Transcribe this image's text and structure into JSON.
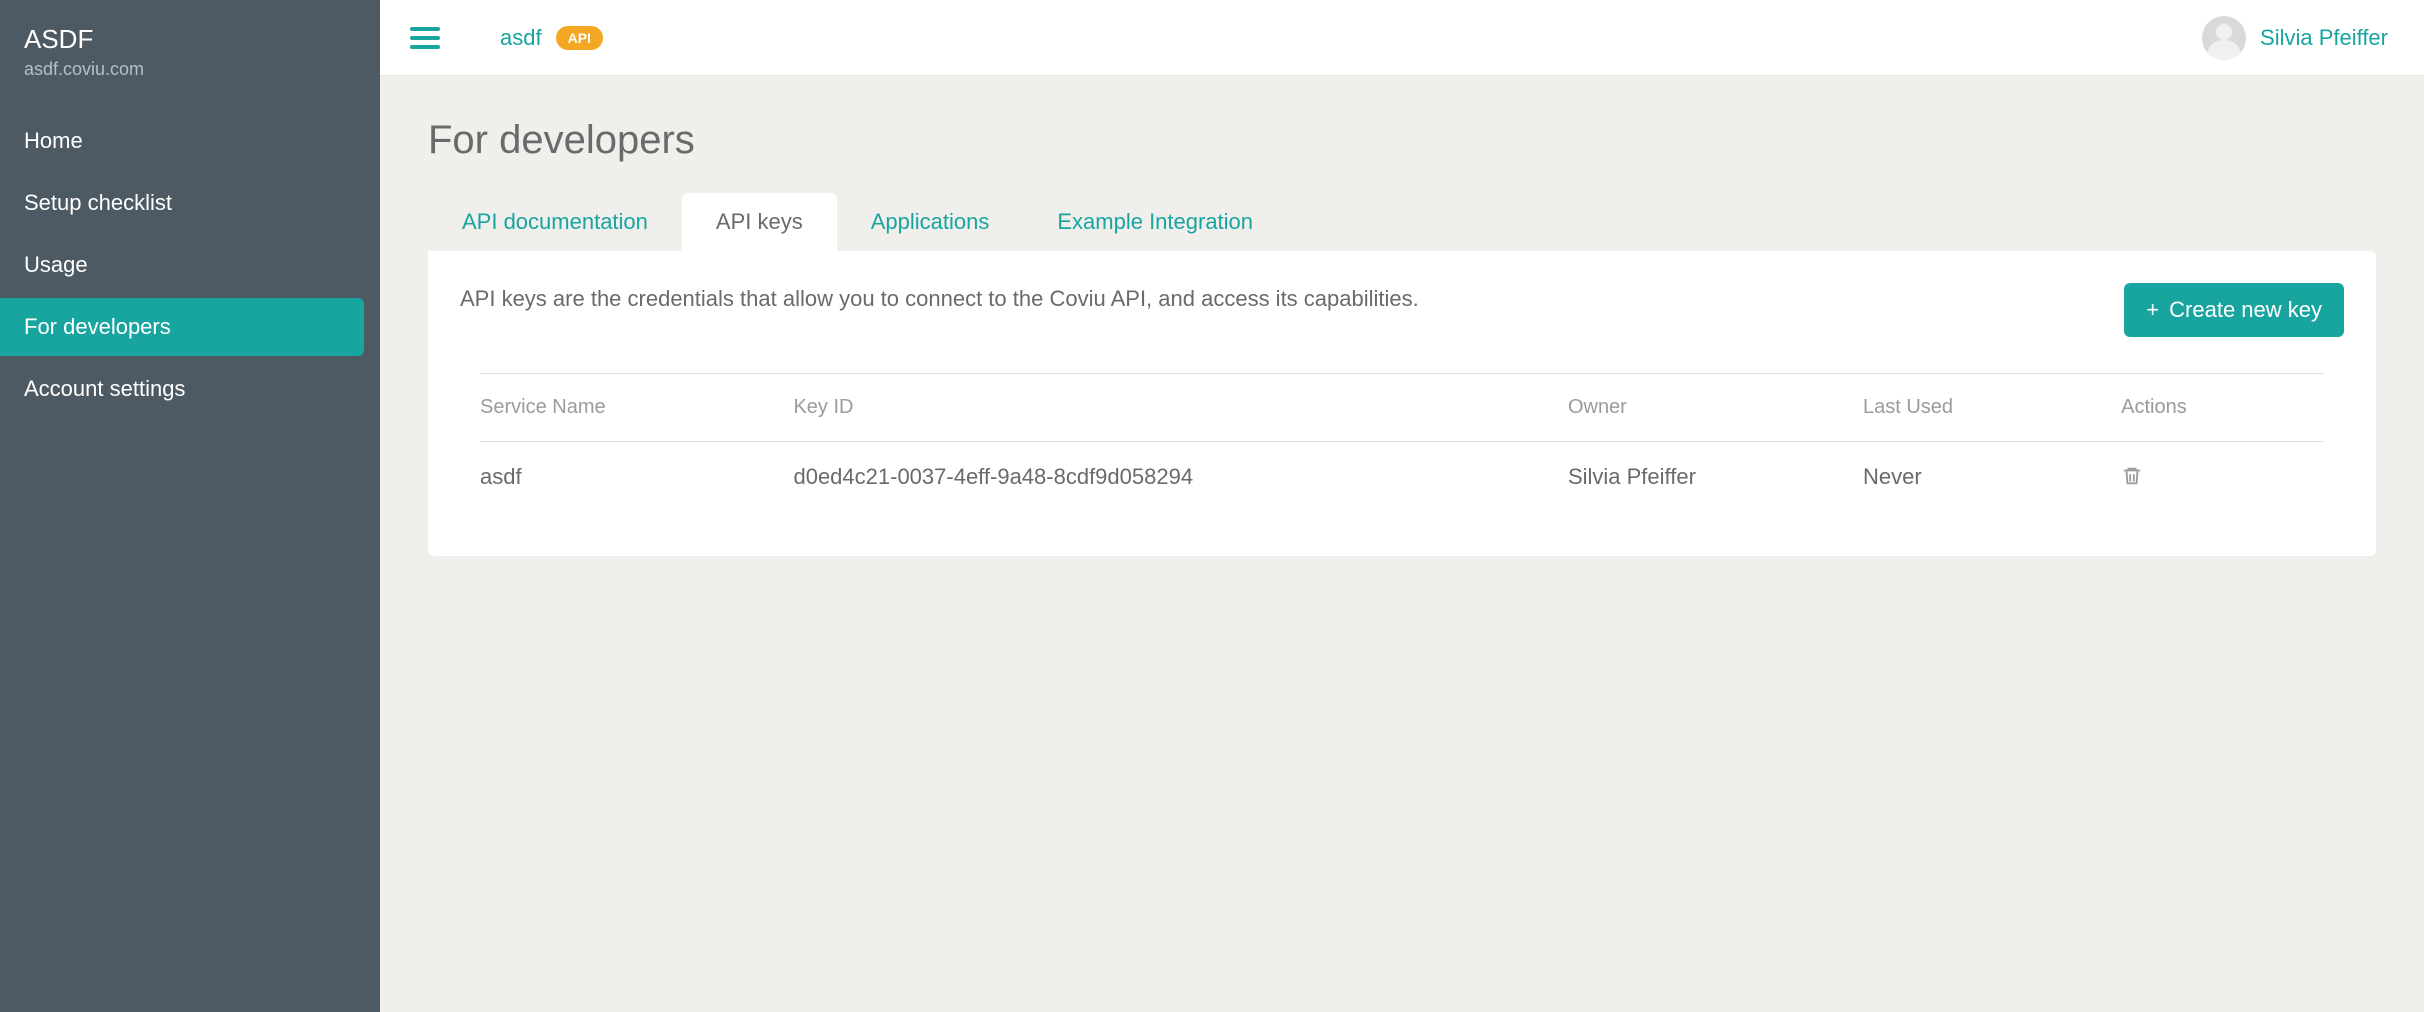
{
  "sidebar": {
    "title": "ASDF",
    "subtitle": "asdf.coviu.com",
    "items": [
      {
        "label": "Home",
        "active": false
      },
      {
        "label": "Setup checklist",
        "active": false
      },
      {
        "label": "Usage",
        "active": false
      },
      {
        "label": "For developers",
        "active": true
      },
      {
        "label": "Account settings",
        "active": false
      }
    ]
  },
  "topbar": {
    "org_name": "asdf",
    "badge": "API",
    "user_name": "Silvia Pfeiffer"
  },
  "page": {
    "title": "For developers",
    "tabs": [
      {
        "label": "API documentation",
        "active": false
      },
      {
        "label": "API keys",
        "active": true
      },
      {
        "label": "Applications",
        "active": false
      },
      {
        "label": "Example Integration",
        "active": false
      }
    ],
    "description": "API keys are the credentials that allow you to connect to the Coviu API, and access its capabilities.",
    "create_button": "Create new key",
    "table": {
      "headers": {
        "service": "Service Name",
        "keyid": "Key ID",
        "owner": "Owner",
        "last": "Last Used",
        "actions": "Actions"
      },
      "rows": [
        {
          "service": "asdf",
          "keyid": "d0ed4c21-0037-4eff-9a48-8cdf9d058294",
          "owner": "Silvia Pfeiffer",
          "last": "Never"
        }
      ]
    }
  }
}
